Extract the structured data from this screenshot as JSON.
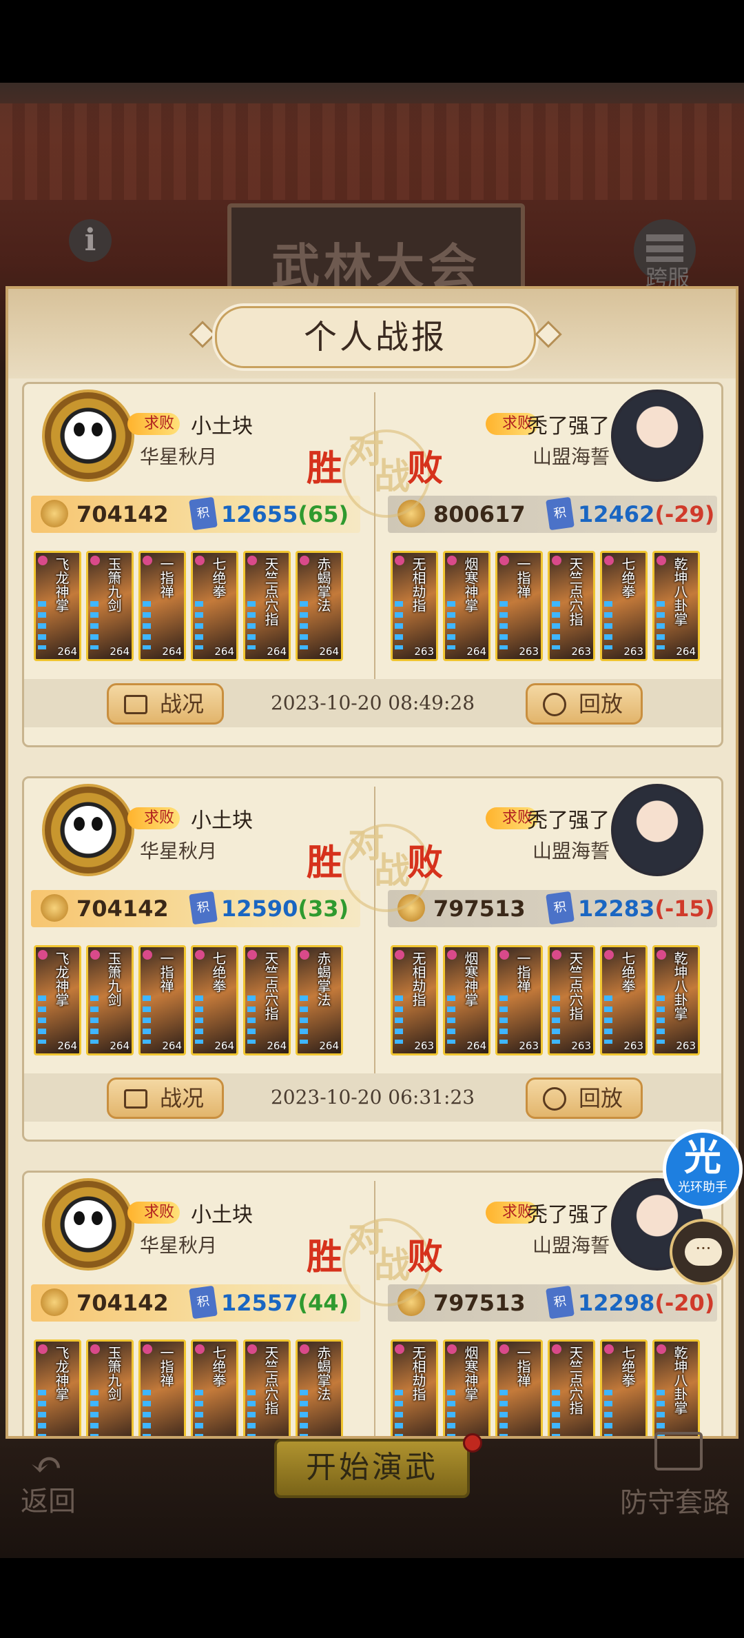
{
  "header": {
    "event_title": "武林大会",
    "info_icon": "info-icon",
    "server_label": "跨服"
  },
  "panel": {
    "title": "个人战报"
  },
  "badge_label": "求败",
  "vs_text": {
    "win": "胜",
    "dui": "对",
    "zhan": "战",
    "lose": "败"
  },
  "buttons": {
    "report": "战况",
    "replay": "回放"
  },
  "battles": [
    {
      "left": {
        "name": "小土块",
        "guild": "华星秋月",
        "power": "704142",
        "score": "12655",
        "delta": "(65)",
        "skills": [
          {
            "name": "飞龙神掌",
            "lvl": "264"
          },
          {
            "name": "玉箫九剑",
            "lvl": "264"
          },
          {
            "name": "一指禅",
            "lvl": "264"
          },
          {
            "name": "七绝拳",
            "lvl": "264"
          },
          {
            "name": "天竺点穴指",
            "lvl": "264"
          },
          {
            "name": "赤蝎掌法",
            "lvl": "264"
          }
        ]
      },
      "right": {
        "name": "秃了强了",
        "guild": "山盟海誓",
        "power": "800617",
        "score": "12462",
        "delta": "(-29)",
        "skills": [
          {
            "name": "无相劫指",
            "lvl": "263"
          },
          {
            "name": "烟寒神掌",
            "lvl": "264"
          },
          {
            "name": "一指禅",
            "lvl": "263"
          },
          {
            "name": "天竺点穴指",
            "lvl": "263"
          },
          {
            "name": "七绝拳",
            "lvl": "263"
          },
          {
            "name": "乾坤八卦掌",
            "lvl": "264"
          }
        ]
      },
      "timestamp": "2023-10-20 08:49:28"
    },
    {
      "left": {
        "name": "小土块",
        "guild": "华星秋月",
        "power": "704142",
        "score": "12590",
        "delta": "(33)",
        "skills": [
          {
            "name": "飞龙神掌",
            "lvl": "264"
          },
          {
            "name": "玉箫九剑",
            "lvl": "264"
          },
          {
            "name": "一指禅",
            "lvl": "264"
          },
          {
            "name": "七绝拳",
            "lvl": "264"
          },
          {
            "name": "天竺点穴指",
            "lvl": "264"
          },
          {
            "name": "赤蝎掌法",
            "lvl": "264"
          }
        ]
      },
      "right": {
        "name": "秃了强了",
        "guild": "山盟海誓",
        "power": "797513",
        "score": "12283",
        "delta": "(-15)",
        "skills": [
          {
            "name": "无相劫指",
            "lvl": "263"
          },
          {
            "name": "烟寒神掌",
            "lvl": "264"
          },
          {
            "name": "一指禅",
            "lvl": "263"
          },
          {
            "name": "天竺点穴指",
            "lvl": "263"
          },
          {
            "name": "七绝拳",
            "lvl": "263"
          },
          {
            "name": "乾坤八卦掌",
            "lvl": "263"
          }
        ]
      },
      "timestamp": "2023-10-20 06:31:23"
    },
    {
      "left": {
        "name": "小土块",
        "guild": "华星秋月",
        "power": "704142",
        "score": "12557",
        "delta": "(44)",
        "skills": [
          {
            "name": "飞龙神掌",
            "lvl": ""
          },
          {
            "name": "玉箫九剑",
            "lvl": ""
          },
          {
            "name": "一指禅",
            "lvl": ""
          },
          {
            "name": "七绝拳",
            "lvl": ""
          },
          {
            "name": "天竺点穴指",
            "lvl": ""
          },
          {
            "name": "赤蝎掌法",
            "lvl": ""
          }
        ]
      },
      "right": {
        "name": "秃了强了",
        "guild": "山盟海誓",
        "power": "797513",
        "score": "12298",
        "delta": "(-20)",
        "skills": [
          {
            "name": "无相劫指",
            "lvl": ""
          },
          {
            "name": "烟寒神掌",
            "lvl": ""
          },
          {
            "name": "一指禅",
            "lvl": ""
          },
          {
            "name": "天竺点穴指",
            "lvl": ""
          },
          {
            "name": "七绝拳",
            "lvl": ""
          },
          {
            "name": "乾坤八卦掌",
            "lvl": ""
          }
        ]
      },
      "timestamp": ""
    }
  ],
  "bottom": {
    "back_label": "返回",
    "start_label": "开始演武",
    "defense_label": "防守套路"
  },
  "floating": {
    "helper_big": "光",
    "helper_small": "光环助手",
    "chat_icon": "chat-bubble-icon"
  },
  "colors": {
    "win_red": "#d6321c",
    "score_blue": "#1a66c2",
    "delta_pos": "#2f9a2f",
    "delta_neg": "#d03a2a",
    "panel_bg": "#efe5cd"
  }
}
